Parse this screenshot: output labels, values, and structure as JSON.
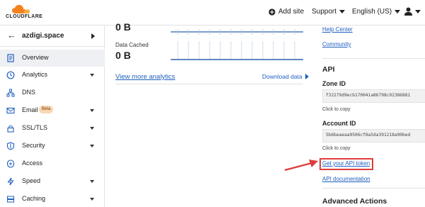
{
  "brand": {
    "name": "CLOUDFLARE",
    "orange": "#f6821f"
  },
  "topnav": {
    "add_site": "Add site",
    "support": "Support",
    "language": "English (US)"
  },
  "site": {
    "name": "azdigi.space"
  },
  "sidebar": {
    "items": [
      {
        "label": "Overview",
        "icon": "document-icon",
        "active": true,
        "has_submenu": false
      },
      {
        "label": "Analytics",
        "icon": "clock-icon",
        "has_submenu": true
      },
      {
        "label": "DNS",
        "icon": "network-icon",
        "has_submenu": false
      },
      {
        "label": "Email",
        "icon": "mail-icon",
        "has_submenu": true,
        "badge": "Beta"
      },
      {
        "label": "SSL/TLS",
        "icon": "lock-icon",
        "has_submenu": true
      },
      {
        "label": "Security",
        "icon": "shield-icon",
        "has_submenu": true
      },
      {
        "label": "Access",
        "icon": "access-icon",
        "has_submenu": false
      },
      {
        "label": "Speed",
        "icon": "lightning-icon",
        "has_submenu": true
      },
      {
        "label": "Caching",
        "icon": "caching-icon",
        "has_submenu": true
      }
    ]
  },
  "main": {
    "metric_top_value": "0 B",
    "data_cached_label": "Data Cached",
    "data_cached_value": "0 B",
    "view_more": "View more analytics",
    "download": "Download data"
  },
  "right": {
    "help_center": "Help Center",
    "community": "Community",
    "api_heading": "API",
    "zone_id_label": "Zone ID",
    "zone_id": "f32279d9ecb170041a86798c92386881",
    "click_to_copy": "Click to copy",
    "account_id_label": "Account ID",
    "account_id": "5b6beaeaa9506cf8a5da391218a90bed",
    "click_to_copy_2": "Click to copy",
    "get_api_token": "Get your API token",
    "api_docs": "API documentation",
    "advanced_actions": "Advanced Actions"
  },
  "colors": {
    "link": "#1f5fbf",
    "highlight": "#e03c3c",
    "sparkline": "#2c5fb2"
  }
}
